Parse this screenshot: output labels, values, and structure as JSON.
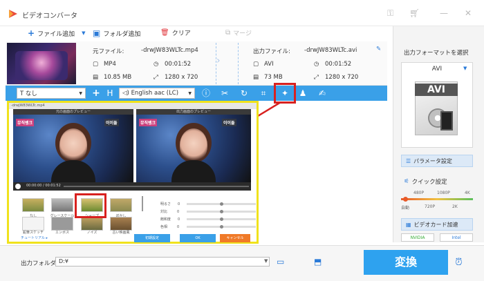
{
  "window": {
    "title": "ビデオコンバータ",
    "controls": {
      "minimize": "—",
      "close": "✕"
    }
  },
  "toolbar": {
    "add_file": "ファイル追加",
    "add_folder": "フォルダ追加",
    "clear": "クリア",
    "merge": "マージ"
  },
  "file": {
    "source_label": "元ファイル:",
    "source_name": "-drwJW83WLTc.mp4",
    "source_format": "MP4",
    "source_duration": "00:01:52",
    "source_size": "10.85 MB",
    "source_resolution": "1280 x 720",
    "output_label": "出力ファイル:",
    "output_name": "-drwJW83WLTc.avi",
    "output_format": "AVI",
    "output_duration": "00:01:52",
    "output_size": "73 MB",
    "output_resolution": "1280 x 720"
  },
  "editbar": {
    "subtitle_select": "なし",
    "audio_select": "English aac (LC)"
  },
  "preview": {
    "window_title": "-drwJW83WLTc.mp4",
    "source_header": "元の画面のプレビュー",
    "output_header": "出力画面のプレビュー",
    "time_display": "00:00:00 / 00:01:52",
    "overlay_left": "뮤직뱅크",
    "overlay_right": "이이돌",
    "filters": [
      {
        "label": "なし"
      },
      {
        "label": "グレースケール"
      },
      {
        "label": "シャープ"
      },
      {
        "label": "ぼかし"
      },
      {
        "label": "鉛筆スケッチ"
      },
      {
        "label": "エンボス"
      },
      {
        "label": "ノイズ"
      },
      {
        "label": "古い映画風"
      }
    ],
    "sliders": [
      {
        "label": "明るさ",
        "value": "0"
      },
      {
        "label": "対比",
        "value": "0"
      },
      {
        "label": "飽和度",
        "value": "0"
      },
      {
        "label": "色相",
        "value": "0"
      }
    ],
    "tutorial_link": "チュートリアル ▸",
    "reset": "初期設定",
    "ok": "OK",
    "cancel": "キャンセル"
  },
  "right_panel": {
    "select_format": "出力フォーマットを選択",
    "format": "AVI",
    "format_card": "AVI",
    "param_settings": "パラメータ設定",
    "quick_settings": "クイック設定",
    "quality_ticks": [
      "480P",
      "1080P",
      "4K"
    ],
    "quality_labels": [
      "自動",
      "720P",
      "2K"
    ],
    "hw_accel": "ビデオカード加速",
    "gpu_nvidia": "NVIDIA",
    "gpu_intel": "Intel"
  },
  "bottom": {
    "output_folder_label": "出力フォルダ:",
    "output_folder_value": "D:¥",
    "convert": "変換"
  },
  "colors": {
    "accent": "#2ea2ef",
    "highlight": "#d8211f",
    "panel_border": "#f0e21c"
  }
}
